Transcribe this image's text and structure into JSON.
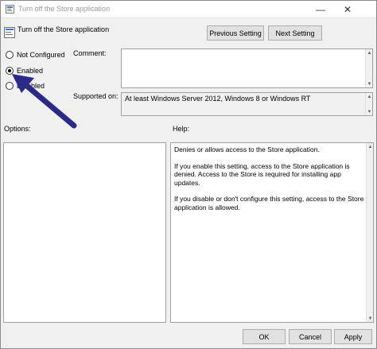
{
  "window": {
    "title": "Turn off the Store application",
    "minimize_glyph": "—",
    "close_glyph": "✕"
  },
  "header": {
    "policy_title": "Turn off the Store application",
    "previous_label": "Previous Setting",
    "next_label": "Next Setting"
  },
  "state": {
    "options": [
      {
        "label": "Not Configured",
        "checked": false
      },
      {
        "label": "Enabled",
        "checked": true
      },
      {
        "label": "Disabled",
        "checked": false
      }
    ]
  },
  "comment": {
    "label": "Comment:",
    "value": ""
  },
  "supported": {
    "label": "Supported on:",
    "value": "At least Windows Server 2012, Windows 8 or Windows RT"
  },
  "options_pane": {
    "label": "Options:"
  },
  "help_pane": {
    "label": "Help:",
    "paragraphs": [
      "Denies or allows access to the Store application.",
      "If you enable this setting, access to the Store application is denied. Access to the Store is required for installing app updates.",
      "If you disable or don't configure this setting, access to the Store application is allowed."
    ]
  },
  "footer": {
    "ok_label": "OK",
    "cancel_label": "Cancel",
    "apply_label": "Apply"
  },
  "annotation": {
    "arrow_color": "#2b2a8a"
  }
}
